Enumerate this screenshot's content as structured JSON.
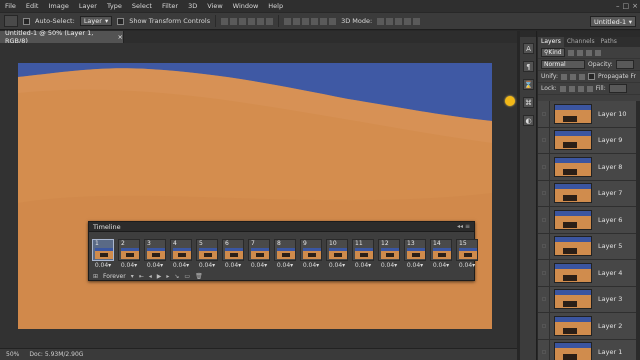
{
  "menubar": {
    "items": [
      "File",
      "Edit",
      "Image",
      "Layer",
      "Type",
      "Select",
      "Filter",
      "3D",
      "View",
      "Window",
      "Help"
    ],
    "window_controls": [
      "–",
      "□",
      "×"
    ]
  },
  "options": {
    "auto_select_label": "Auto-Select:",
    "auto_select_value": "Layer",
    "show_transform_label": "Show Transform Controls",
    "mode_label": "3D Mode:",
    "workspace_value": "Untitled-1"
  },
  "document": {
    "tab_title": "Untitled-1 @ 50% (Layer 1, RGB/8)",
    "close_glyph": "×"
  },
  "status": {
    "zoom": "50%",
    "doc_info": "Doc: 5.93M/2.90G"
  },
  "timeline": {
    "title": "Timeline",
    "header_controls": "◂◂ ≡",
    "frames": [
      {
        "num": "1",
        "delay": "0.04▾"
      },
      {
        "num": "2",
        "delay": "0.04▾"
      },
      {
        "num": "3",
        "delay": "0.04▾"
      },
      {
        "num": "4",
        "delay": "0.04▾"
      },
      {
        "num": "5",
        "delay": "0.04▾"
      },
      {
        "num": "6",
        "delay": "0.04▾"
      },
      {
        "num": "7",
        "delay": "0.04▾"
      },
      {
        "num": "8",
        "delay": "0.04▾"
      },
      {
        "num": "9",
        "delay": "0.04▾"
      },
      {
        "num": "10",
        "delay": "0.04▾"
      },
      {
        "num": "11",
        "delay": "0.04▾"
      },
      {
        "num": "12",
        "delay": "0.04▾"
      },
      {
        "num": "13",
        "delay": "0.04▾"
      },
      {
        "num": "14",
        "delay": "0.04▾"
      },
      {
        "num": "15",
        "delay": "0.04▾"
      }
    ],
    "loop_value": "Forever",
    "controls": [
      "⇤",
      "◂",
      "▶",
      "▸",
      "↘",
      "▭",
      "🗑"
    ]
  },
  "layers_panel": {
    "tabs": [
      "Layers",
      "Channels",
      "Paths"
    ],
    "filter_label": "Kind",
    "blend_mode": "Normal",
    "opacity_label": "Opacity:",
    "unify_label": "Unify:",
    "propagate_label": "Propagate Fr",
    "lock_label": "Lock:",
    "fill_label": "Fill:",
    "layers": [
      "Layer 10",
      "Layer 9",
      "Layer 8",
      "Layer 7",
      "Layer 6",
      "Layer 5",
      "Layer 4",
      "Layer 3",
      "Layer 2",
      "Layer 1"
    ]
  },
  "colors": {
    "sky": "#3f59a4",
    "sand": "#d48d4e",
    "accent_cursor": "#f2b818"
  }
}
